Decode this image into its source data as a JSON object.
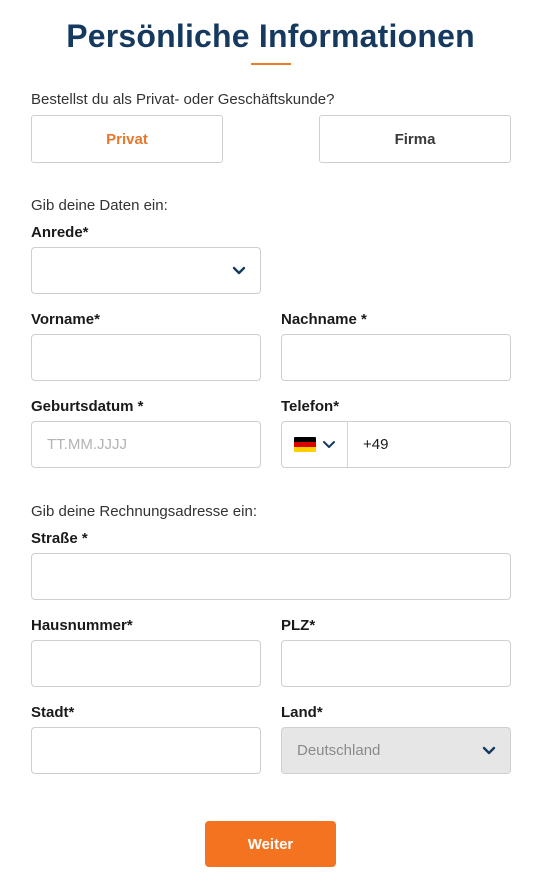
{
  "title": "Persönliche Informationen",
  "customer_type": {
    "question": "Bestellst du als Privat- oder Geschäftskunde?",
    "options": [
      "Privat",
      "Firma"
    ],
    "selected": "Privat"
  },
  "personal": {
    "section_label": "Gib deine Daten ein:",
    "salutation_label": "Anrede*",
    "salutation_value": "",
    "firstname_label": "Vorname*",
    "firstname_value": "",
    "lastname_label": "Nachname *",
    "lastname_value": "",
    "birthdate_label": "Geburtsdatum *",
    "birthdate_placeholder": "TT.MM.JJJJ",
    "birthdate_value": "",
    "phone_label": "Telefon*",
    "phone_country_icon": "germany-flag-icon",
    "phone_value": "+49"
  },
  "billing": {
    "section_label": "Gib deine Rechnungsadresse ein:",
    "street_label": "Straße *",
    "street_value": "",
    "housenumber_label": "Hausnummer*",
    "housenumber_value": "",
    "zip_label": "PLZ*",
    "zip_value": "",
    "city_label": "Stadt*",
    "city_value": "",
    "country_label": "Land*",
    "country_value": "Deutschland"
  },
  "next_button": "Weiter",
  "colors": {
    "title": "#163a5f",
    "accent": "#f37321",
    "chevron": "#163a5f"
  }
}
